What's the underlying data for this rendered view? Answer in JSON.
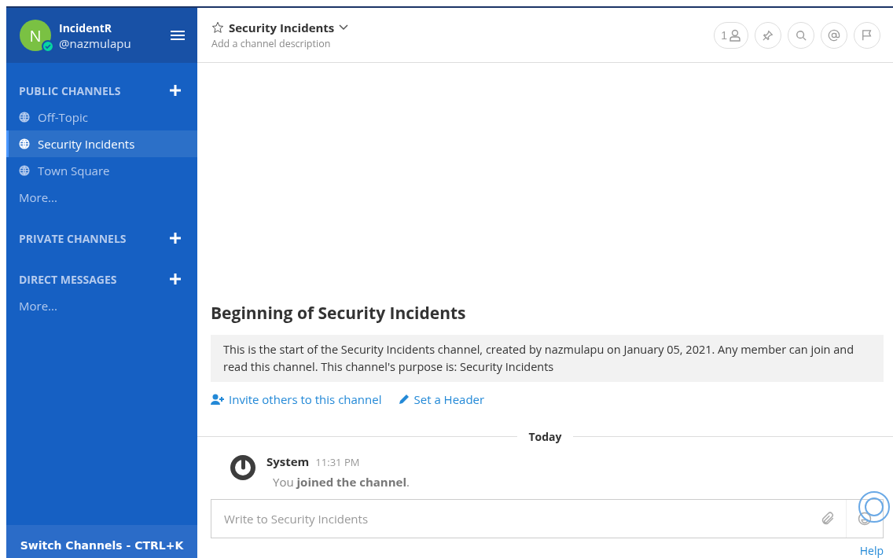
{
  "team": {
    "initial": "N",
    "name": "IncidentR",
    "username": "@nazmulapu",
    "online": true
  },
  "sections": [
    {
      "title": "PUBLIC CHANNELS",
      "channels": [
        {
          "name": "Off-Topic",
          "selected": false
        },
        {
          "name": "Security Incidents",
          "selected": true
        },
        {
          "name": "Town Square",
          "selected": false
        }
      ],
      "more": "More..."
    },
    {
      "title": "PRIVATE CHANNELS"
    },
    {
      "title": "DIRECT MESSAGES",
      "more": "More..."
    }
  ],
  "switch_channels": "Switch Channels - CTRL+K",
  "header": {
    "title": "Security Incidents",
    "favorite": false,
    "description": "Add a channel description",
    "member_count": "1"
  },
  "intro": {
    "title": "Beginning of Security Incidents",
    "text": "This is the start of the Security Incidents channel, created by nazmulapu on January 05, 2021. Any member can join and read this channel. This channel's purpose is: Security Incidents",
    "actions": [
      {
        "kind": "invite",
        "label": "Invite others to this channel"
      },
      {
        "kind": "header",
        "label": "Set a Header"
      }
    ]
  },
  "separator": "Today",
  "messages": [
    {
      "author": "System",
      "time": "11:31 PM",
      "text": "You **joined the channel**."
    }
  ],
  "composer": {
    "placeholder": "Write to Security Incidents"
  },
  "help": "Help"
}
